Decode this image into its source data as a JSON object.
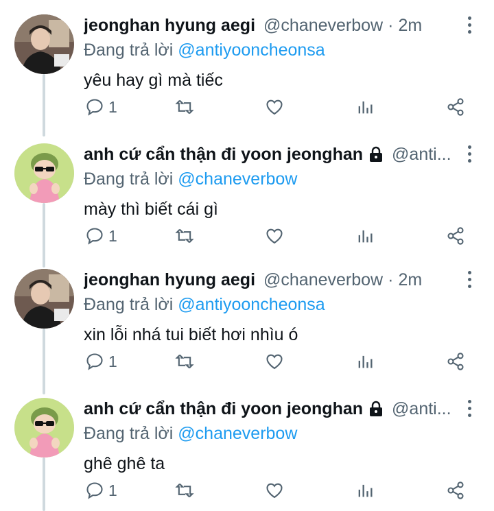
{
  "reply_prefix": "Đang trả lời",
  "tweets": [
    {
      "author": "jeonghan hyung aegi",
      "handle": "@chaneverbow",
      "time": "2m",
      "separator": "·",
      "reply_to": "@antiyooncheonsa",
      "text": "yêu hay gì mà tiếc",
      "reply_count": "1",
      "locked": false,
      "avatar": "person-photo"
    },
    {
      "author": "anh cứ cẩn thận đi yoon jeonghan",
      "handle": "@anti...",
      "time": "",
      "separator": "",
      "reply_to": "@chaneverbow",
      "text": "mày thì biết cái gì",
      "reply_count": "1",
      "locked": true,
      "avatar": "cartoon-sunglasses"
    },
    {
      "author": "jeonghan hyung aegi",
      "handle": "@chaneverbow",
      "time": "2m",
      "separator": "·",
      "reply_to": "@antiyooncheonsa",
      "text": "xin lỗi nhá tui biết hơi nhìu ó",
      "reply_count": "1",
      "locked": false,
      "avatar": "person-photo"
    },
    {
      "author": "anh cứ cẩn thận đi yoon jeonghan",
      "handle": "@anti...",
      "time": "",
      "separator": "",
      "reply_to": "@chaneverbow",
      "text": "ghê ghê ta",
      "reply_count": "1",
      "locked": true,
      "avatar": "cartoon-sunglasses"
    }
  ],
  "colors": {
    "link": "#1d9bf0",
    "muted": "#536471",
    "text": "#0f1419",
    "thread_line": "#cfd9de"
  }
}
